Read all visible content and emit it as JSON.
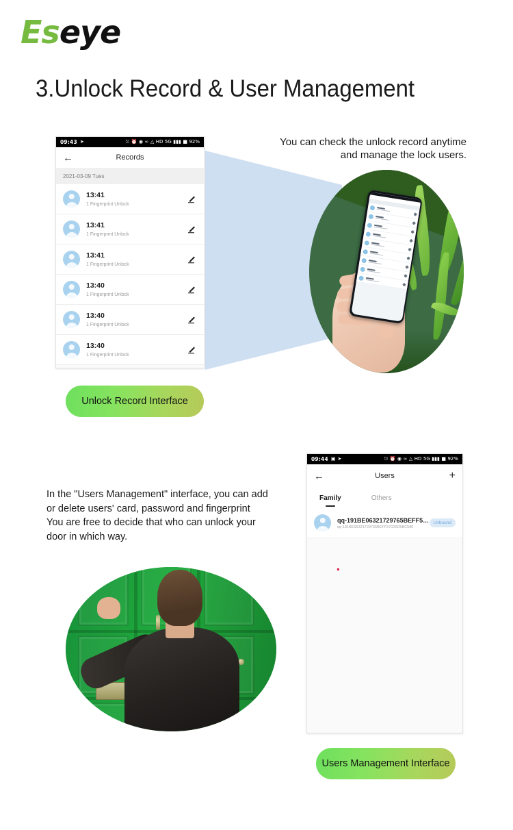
{
  "brand": {
    "logo_green": "Es",
    "logo_black": "eye",
    "green": "#76bb40"
  },
  "page_title": "3.Unlock Record & User Management",
  "section_records": {
    "caption": "You can check the unlock record anytime\nand manage the lock users.",
    "caption_line1": "You can check the unlock record anytime",
    "caption_line2": "and manage the lock users.",
    "pill_label": "Unlock Record Interface",
    "phone": {
      "statusbar": {
        "clock": "09:43",
        "left_icons": [
          "location-arrow-icon"
        ],
        "right_icons": [
          "keyboard-icon",
          "alarm-icon",
          "settings-icon",
          "glasses-icon",
          "wifi-icon"
        ],
        "network_hd": "HD",
        "network_gen": "5G",
        "signal": "signal-bars-icon",
        "battery_icon": "battery-icon",
        "battery": "92%"
      },
      "appbar": {
        "back_icon": "back-arrow-icon",
        "title": "Records"
      },
      "date_header": "2021-03-09 Tues",
      "records": [
        {
          "time": "13:41",
          "detail": "1 Fingerprint Unlock"
        },
        {
          "time": "13:41",
          "detail": "1 Fingerprint Unlock"
        },
        {
          "time": "13:41",
          "detail": "1 Fingerprint Unlock"
        },
        {
          "time": "13:40",
          "detail": "1 Fingerprint Unlock"
        },
        {
          "time": "13:40",
          "detail": "1 Fingerprint Unlock"
        },
        {
          "time": "13:40",
          "detail": "1 Fingerprint Unlock"
        }
      ]
    },
    "photo_alt": "hand-holding-phone-with-leaves"
  },
  "section_users": {
    "caption_line1": "In the \"Users Management\" interface, you can add",
    "caption_line2": "or delete users' card, password and fingerprint",
    "caption_line3": "You are free to decide that who can unlock your",
    "caption_line4": "door in which way.",
    "pill_label": "Users Management Interface",
    "phone": {
      "statusbar": {
        "clock": "09:44",
        "left_icons": [
          "sim-icon",
          "location-arrow-icon"
        ],
        "right_icons": [
          "keyboard-icon",
          "alarm-icon",
          "settings-icon",
          "glasses-icon",
          "wifi-icon"
        ],
        "network_hd": "HD",
        "network_gen": "5G",
        "signal": "signal-bars-icon",
        "battery_icon": "battery-icon",
        "battery": "92%"
      },
      "appbar": {
        "back_icon": "back-arrow-icon",
        "title": "Users",
        "add_icon": "plus-icon"
      },
      "tabs": [
        {
          "label": "Family",
          "active": true
        },
        {
          "label": "Others",
          "active": false
        }
      ],
      "users": [
        {
          "name": "qq-191BE06321729765BEFF570...",
          "id": "qq-191BE06321729765BEFF57026D5BC580",
          "status": "Unbound"
        }
      ]
    },
    "photo_alt": "man-knocking-on-green-door"
  }
}
